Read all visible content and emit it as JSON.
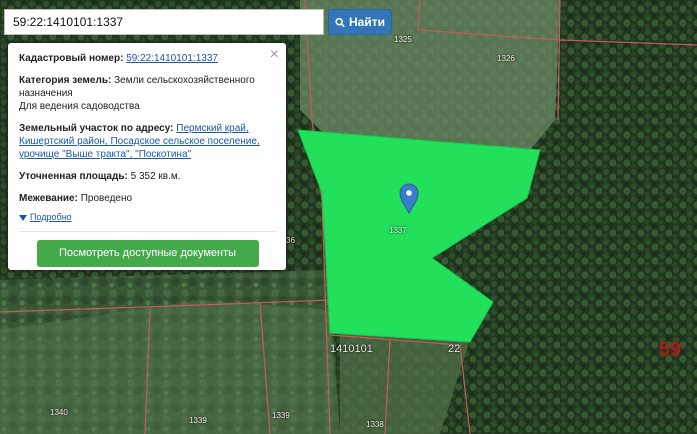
{
  "search": {
    "value": "59:22:1410101:1337",
    "button_label": "Найти"
  },
  "popup": {
    "cadastral_label": "Кадастровый номер:",
    "cadastral_value": "59:22:1410101:1337",
    "category_label": "Категория земель:",
    "category_value": "Земли сельскохозяйственного назначения",
    "usage_value": "Для ведения садоводства",
    "address_label": "Земельный участок по адресу:",
    "address_value": "Пермский край, Кишертский район, Посадское сельское поселение, урочище \"Выше тракта\", \"Поскотина\"",
    "area_label": "Уточненная площадь:",
    "area_value": "5 352 кв.м.",
    "survey_label": "Межевание:",
    "survey_value": "Проведено",
    "more_label": "Подробно",
    "docs_button_label": "Посмотреть доступные документы",
    "close_symbol": "×"
  },
  "map": {
    "parcel_labels": [
      "1325",
      "1326",
      "1337",
      "1410101",
      "22",
      "36",
      "1340",
      "1339",
      "1339",
      "1338"
    ],
    "region_number": "59",
    "parcel_fill_color": "#22e05a",
    "boundary_color": "#c65b5b"
  }
}
